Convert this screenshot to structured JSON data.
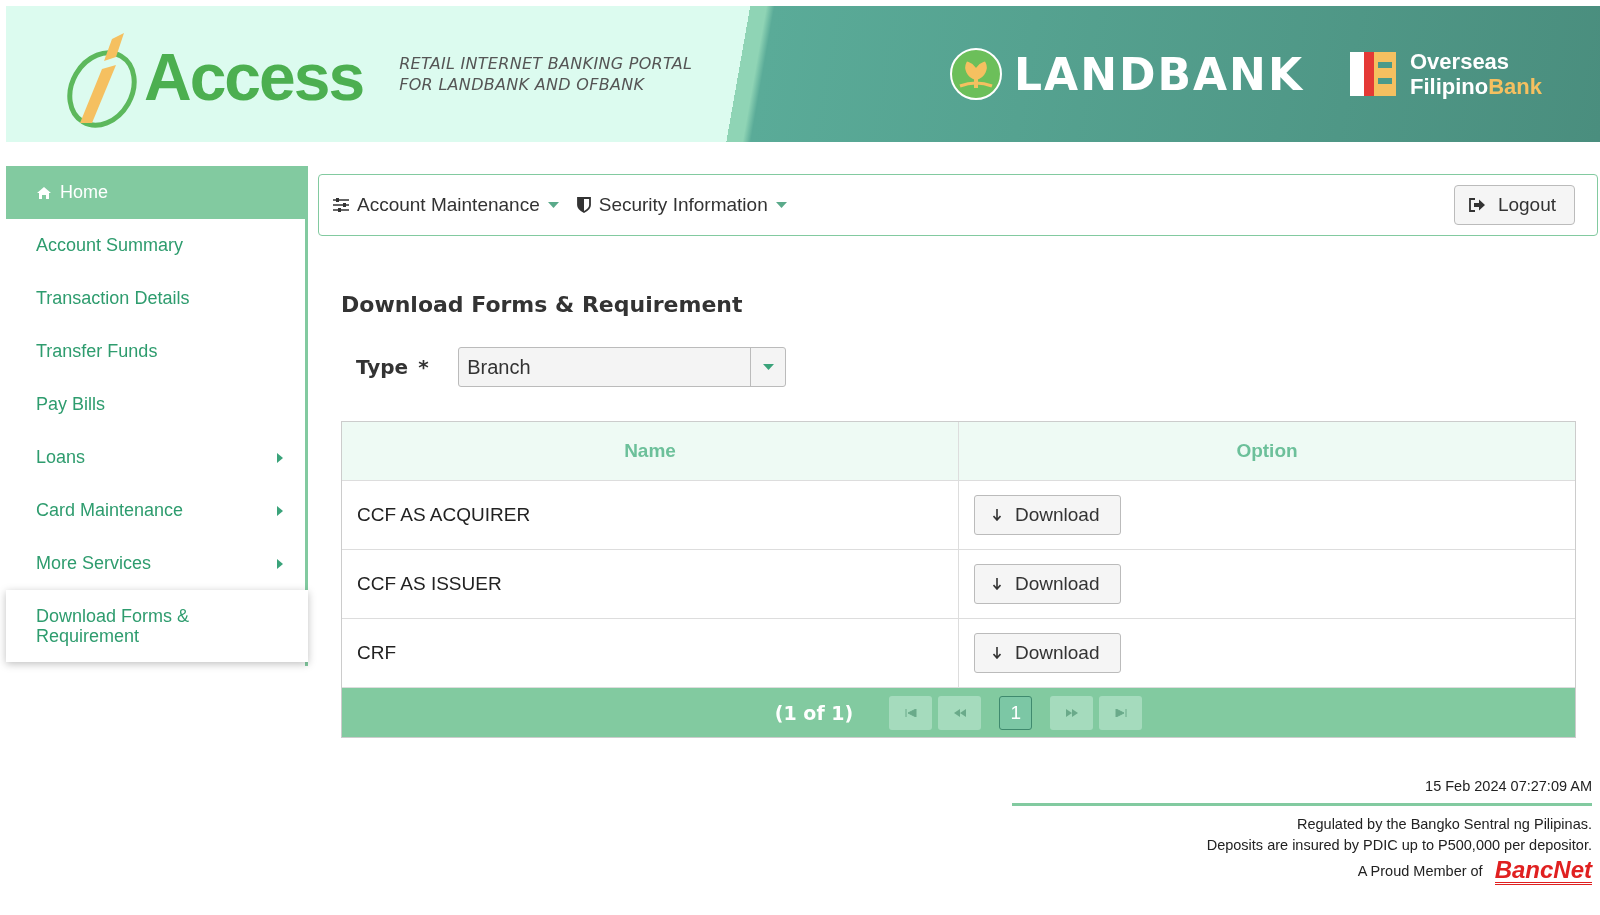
{
  "header": {
    "logo_text": "Access",
    "tagline": [
      "RETAIL INTERNET BANKING PORTAL",
      "FOR LANDBANK AND OFBANK"
    ],
    "landbank": "LANDBANK",
    "ofbank": {
      "line1": "Overseas",
      "line2a": "Filipino",
      "line2b": "Bank"
    }
  },
  "sidebar": {
    "items": [
      {
        "label": "Home",
        "kind": "home",
        "selected": false
      },
      {
        "label": "Account Summary",
        "kind": "link",
        "selected": false
      },
      {
        "label": "Transaction Details",
        "kind": "link",
        "selected": false
      },
      {
        "label": "Transfer Funds",
        "kind": "link",
        "selected": false
      },
      {
        "label": "Pay Bills",
        "kind": "link",
        "selected": false
      },
      {
        "label": "Loans",
        "kind": "submenu",
        "selected": false
      },
      {
        "label": "Card Maintenance",
        "kind": "submenu",
        "selected": false
      },
      {
        "label": "More Services",
        "kind": "submenu",
        "selected": false
      },
      {
        "label": "Download Forms & Requirement",
        "kind": "link",
        "selected": true
      }
    ]
  },
  "menubar": {
    "menus": [
      {
        "label": "Account Maintenance"
      },
      {
        "label": "Security Information"
      }
    ],
    "logout": "Logout"
  },
  "page": {
    "title": "Download Forms & Requirement",
    "type_label": "Type",
    "required_mark": "*",
    "type_value": "Branch"
  },
  "table": {
    "columns": [
      "Name",
      "Option"
    ],
    "rows": [
      {
        "name": "CCF AS ACQUIRER",
        "action": "Download"
      },
      {
        "name": "CCF AS ISSUER",
        "action": "Download"
      },
      {
        "name": "CRF",
        "action": "Download"
      }
    ],
    "pager": {
      "summary": "(1 of 1)",
      "pages": [
        {
          "label": "1",
          "selected": true
        }
      ]
    }
  },
  "footer": {
    "timestamp": "15 Feb 2024 07:27:09 AM",
    "lines": [
      "Regulated by the Bangko Sentral ng Pilipinas.",
      "Deposits are insured by PDIC up to P500,000 per depositor."
    ],
    "member": "A Proud Member of",
    "member_logo": "BancNet"
  }
}
